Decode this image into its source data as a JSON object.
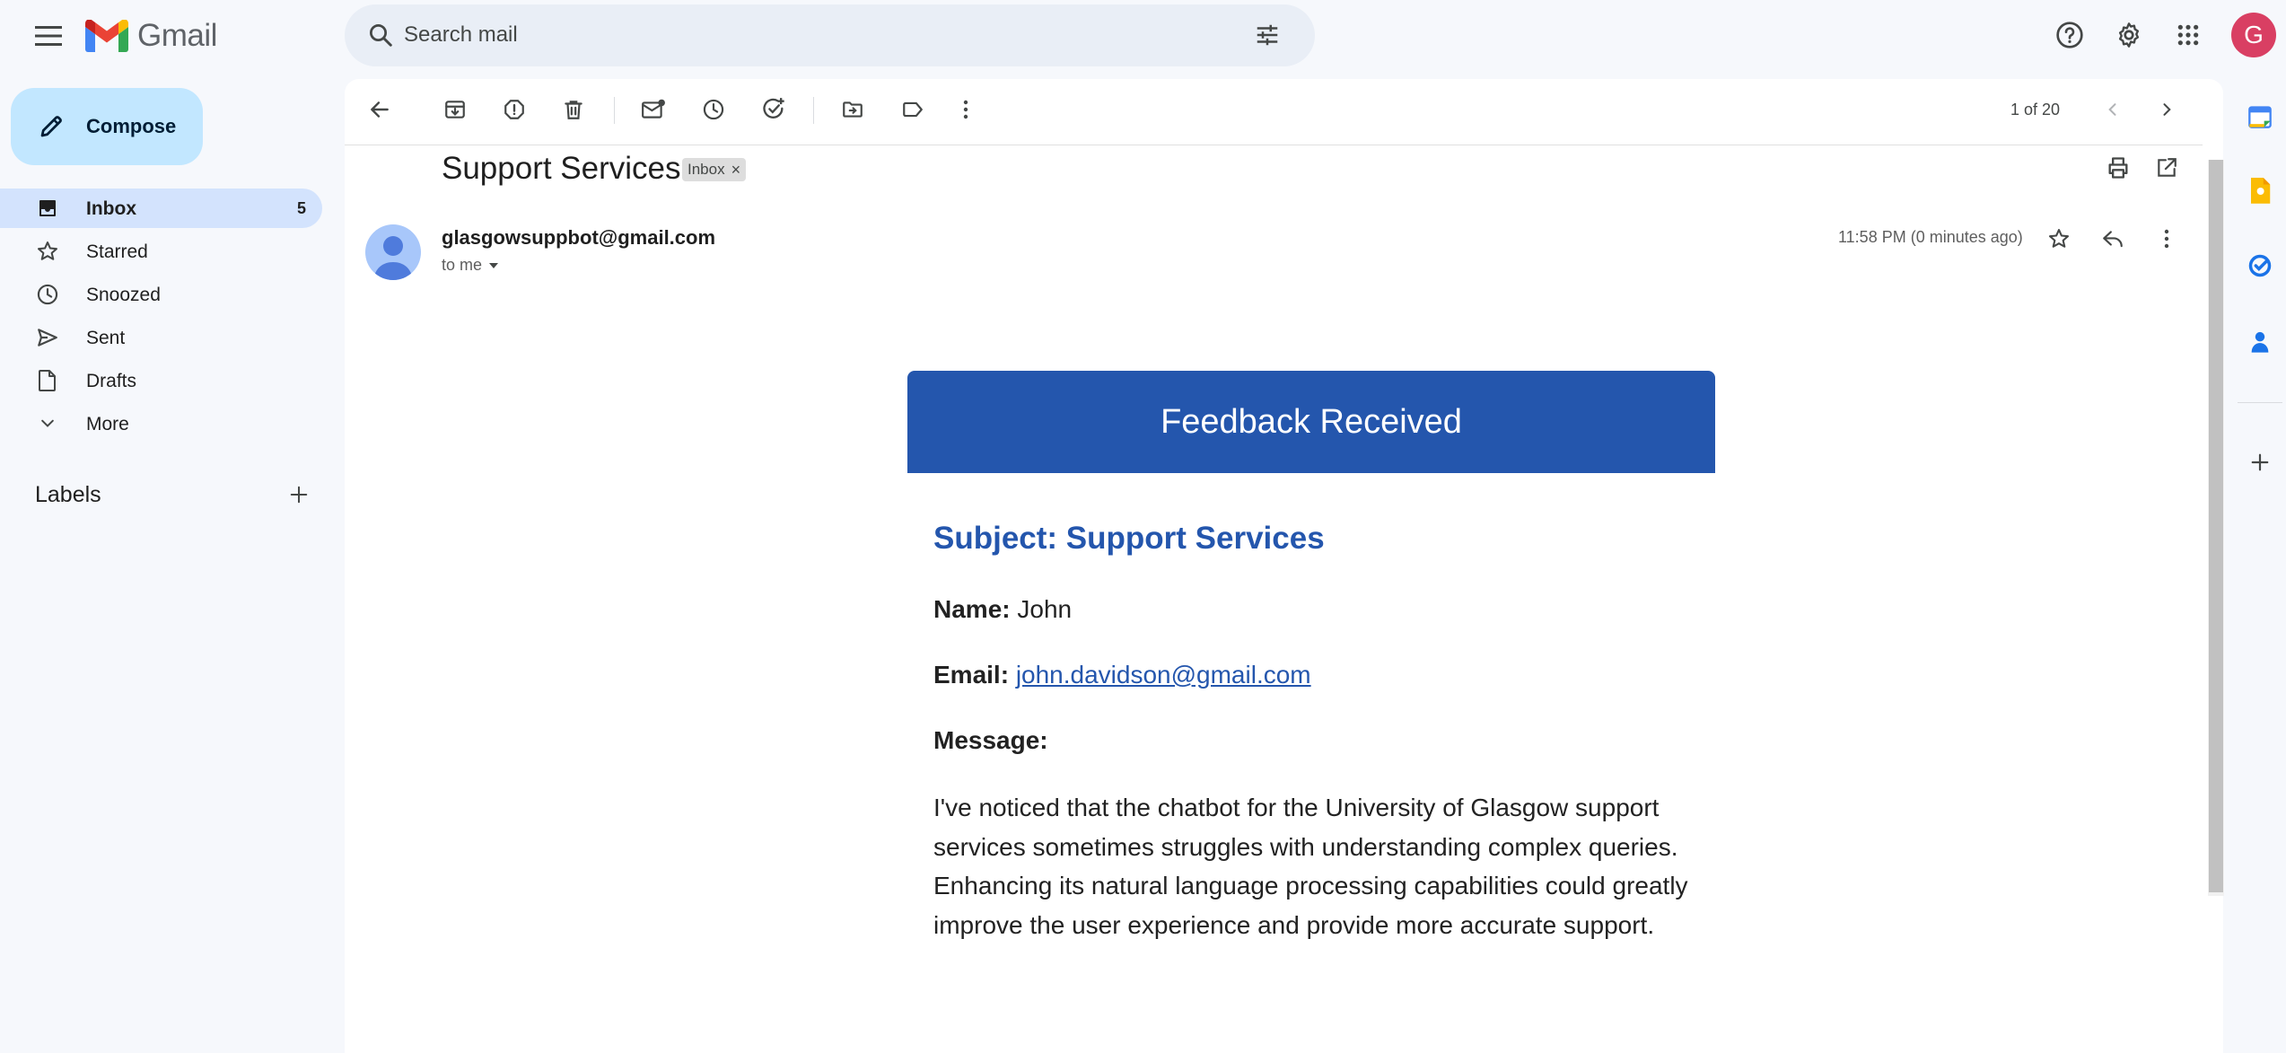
{
  "app": {
    "name": "Gmail"
  },
  "search": {
    "placeholder": "Search mail"
  },
  "header": {
    "avatar_initial": "G",
    "avatar_color": "#d93f63"
  },
  "compose": {
    "label": "Compose"
  },
  "nav": {
    "items": [
      {
        "label": "Inbox",
        "count": "5",
        "icon": "inbox-icon",
        "active": true
      },
      {
        "label": "Starred",
        "icon": "star-icon"
      },
      {
        "label": "Snoozed",
        "icon": "clock-icon"
      },
      {
        "label": "Sent",
        "icon": "send-icon"
      },
      {
        "label": "Drafts",
        "icon": "draft-icon"
      },
      {
        "label": "More",
        "icon": "chevron-down-icon"
      }
    ]
  },
  "labels": {
    "heading": "Labels"
  },
  "toolbar": {
    "pager": "1 of 20"
  },
  "thread": {
    "subject": "Support Services",
    "chip": "Inbox",
    "sender": "glasgowsuppbot@gmail.com",
    "recipient": "to me",
    "timestamp": "11:58 PM (0 minutes ago)"
  },
  "email_body": {
    "banner_title": "Feedback Received",
    "subject_line": "Subject: Support Services",
    "name_label": "Name:",
    "name_value": "John",
    "email_label": "Email:",
    "email_value": "john.davidson@gmail.com",
    "message_label": "Message:",
    "message_text": "I've noticed that the chatbot for the University of Glasgow support services sometimes struggles with understanding complex queries. Enhancing its natural language processing capabilities could greatly improve the user experience and provide more accurate support."
  },
  "colors": {
    "banner": "#2456ad",
    "link": "#2456ad",
    "compose_bg": "#c2e7ff",
    "active_nav_bg": "#d3e3fd",
    "page_bg": "#f6f8fc"
  }
}
